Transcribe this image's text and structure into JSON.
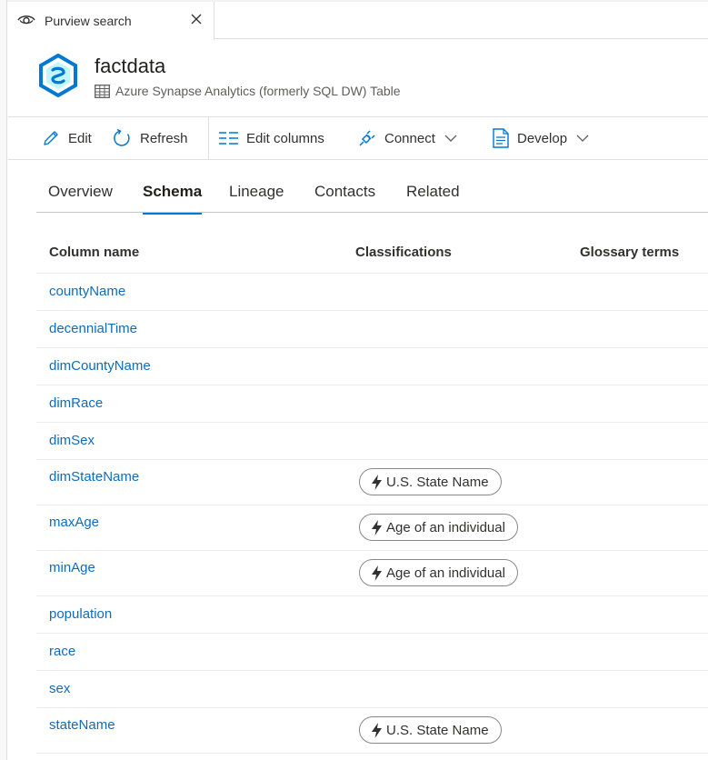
{
  "tab": {
    "label": "Purview search",
    "icon": "eye-icon",
    "close_icon": "close-icon"
  },
  "asset": {
    "name": "factdata",
    "type": "Azure Synapse Analytics (formerly SQL DW) Table",
    "icon": "synapse-icon",
    "type_icon": "table-icon",
    "icon_color": "#0078d4"
  },
  "toolbar": {
    "edit": "Edit",
    "refresh": "Refresh",
    "edit_columns": "Edit columns",
    "connect": "Connect",
    "develop": "Develop"
  },
  "tabs": {
    "overview": "Overview",
    "schema": "Schema",
    "lineage": "Lineage",
    "contacts": "Contacts",
    "related": "Related",
    "active": "Schema"
  },
  "schema": {
    "headers": {
      "column_name": "Column name",
      "classifications": "Classifications",
      "glossary_terms": "Glossary terms"
    },
    "rows": [
      {
        "name": "countyName",
        "classification": ""
      },
      {
        "name": "decennialTime",
        "classification": ""
      },
      {
        "name": "dimCountyName",
        "classification": ""
      },
      {
        "name": "dimRace",
        "classification": ""
      },
      {
        "name": "dimSex",
        "classification": ""
      },
      {
        "name": "dimStateName",
        "classification": "U.S. State Name"
      },
      {
        "name": "maxAge",
        "classification": "Age of an individual"
      },
      {
        "name": "minAge",
        "classification": "Age of an individual"
      },
      {
        "name": "population",
        "classification": ""
      },
      {
        "name": "race",
        "classification": ""
      },
      {
        "name": "sex",
        "classification": ""
      },
      {
        "name": "stateName",
        "classification": "U.S. State Name"
      }
    ]
  },
  "colors": {
    "link": "#0f6cbd",
    "accent": "#0078d4"
  }
}
